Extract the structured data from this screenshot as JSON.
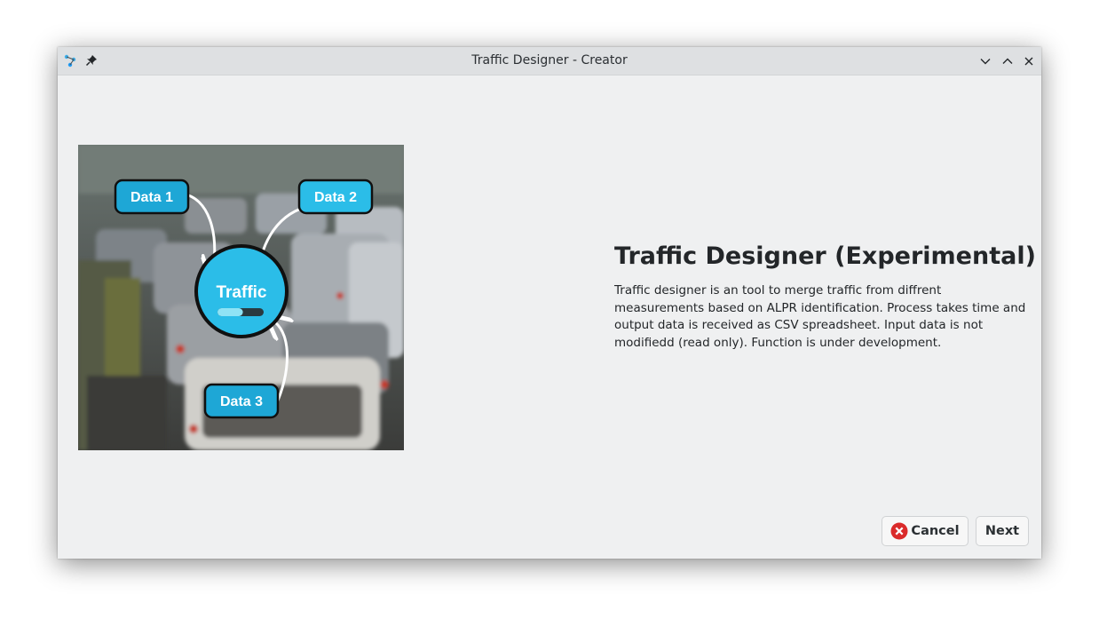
{
  "window": {
    "title": "Traffic Designer - Creator"
  },
  "illustration": {
    "center_label": "Traffic",
    "nodes": [
      "Data 1",
      "Data 2",
      "Data 3"
    ],
    "progress": 0.55
  },
  "content": {
    "heading": "Traffic Designer (Experimental)",
    "description": "Traffic designer is an tool to merge traffic from diffrent measurements based on ALPR identification. Process takes time and output data is received as CSV spreadsheet. Input data is not modifiedd (read only). Function is under development."
  },
  "buttons": {
    "cancel": "Cancel",
    "next": "Next"
  },
  "colors": {
    "bubble": "#2bbde8",
    "node": "#1ea7d6",
    "window_bg": "#eff0f1",
    "titlebar_bg": "#dee0e2",
    "cancel_icon": "#da2a2a"
  }
}
